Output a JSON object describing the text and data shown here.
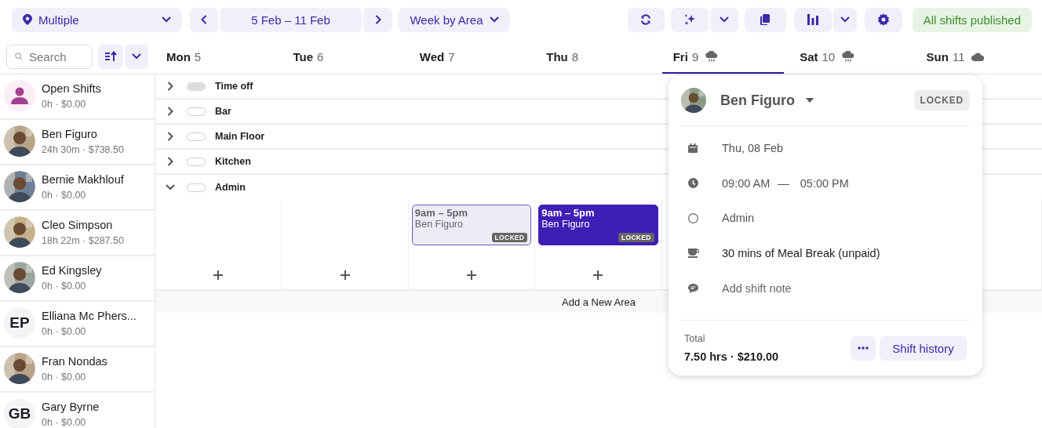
{
  "toolbar": {
    "location": "Multiple",
    "date_range": "5 Feb – 11 Feb",
    "view": "Week by Area",
    "status": "All shifts published"
  },
  "search": {
    "placeholder": "Search"
  },
  "days": [
    {
      "name": "Mon",
      "date": "5",
      "selected": false,
      "kind": "plain"
    },
    {
      "name": "Tue",
      "date": "6",
      "selected": false,
      "kind": "plain"
    },
    {
      "name": "Wed",
      "date": "7",
      "selected": false,
      "kind": "plain"
    },
    {
      "name": "Thu",
      "date": "8",
      "selected": false,
      "kind": "plain"
    },
    {
      "name": "Fri",
      "date": "9",
      "selected": true,
      "kind": "rain"
    },
    {
      "name": "Sat",
      "date": "10",
      "selected": false,
      "kind": "rain"
    },
    {
      "name": "Sun",
      "date": "11",
      "selected": false,
      "kind": "cloud"
    }
  ],
  "staff": [
    {
      "name": "Open Shifts",
      "summary": "0h · $0.00",
      "avatar": {
        "kind": "open"
      }
    },
    {
      "name": "Ben Figuro",
      "summary": "24h 30m · $738.50"
    },
    {
      "name": "Bernie Makhlouf",
      "summary": "0h · $0.00"
    },
    {
      "name": "Cleo Simpson",
      "summary": "18h 22m · $287.50"
    },
    {
      "name": "Ed Kingsley",
      "summary": "0h · $0.00"
    },
    {
      "name": "Elliana Mc Phers...",
      "summary": "0h · $0.00",
      "avatar": {
        "kind": "initials",
        "text": "EP"
      }
    },
    {
      "name": "Fran Nondas",
      "summary": "0h · $0.00"
    },
    {
      "name": "Gary Byrne",
      "summary": "0h · $0.00",
      "avatar": {
        "kind": "initials",
        "text": "GB"
      }
    }
  ],
  "areas": [
    {
      "name": "Time off",
      "expanded": false,
      "on": true
    },
    {
      "name": "Bar",
      "expanded": false,
      "on": false
    },
    {
      "name": "Main Floor",
      "expanded": false,
      "on": false
    },
    {
      "name": "Kitchen",
      "expanded": false,
      "on": false
    },
    {
      "name": "Admin",
      "expanded": true,
      "on": false,
      "cells": [
        {
          "kind": "empty"
        },
        {
          "kind": "empty"
        },
        {
          "kind": "shift",
          "time": "9am – 5pm",
          "name": "Ben Figuro",
          "badge": "LOCKED",
          "selected": false
        },
        {
          "kind": "shift",
          "time": "9am – 5pm",
          "name": "Ben Figuro",
          "badge": "LOCKED",
          "selected": true
        },
        {
          "kind": "empty"
        },
        {
          "kind": "empty"
        },
        {
          "kind": "empty"
        }
      ]
    }
  ],
  "add_area": "Add a New Area",
  "popover": {
    "name": "Ben Figuro",
    "badge": "LOCKED",
    "date": "Thu, 08 Feb",
    "start": "09:00 AM",
    "separator": "—",
    "end": "05:00 PM",
    "area": "Admin",
    "break": "30 mins of Meal Break (unpaid)",
    "note_placeholder": "Add shift note",
    "total_label": "Total",
    "total": "7.50 hrs · $210.00",
    "history_button": "Shift history"
  }
}
